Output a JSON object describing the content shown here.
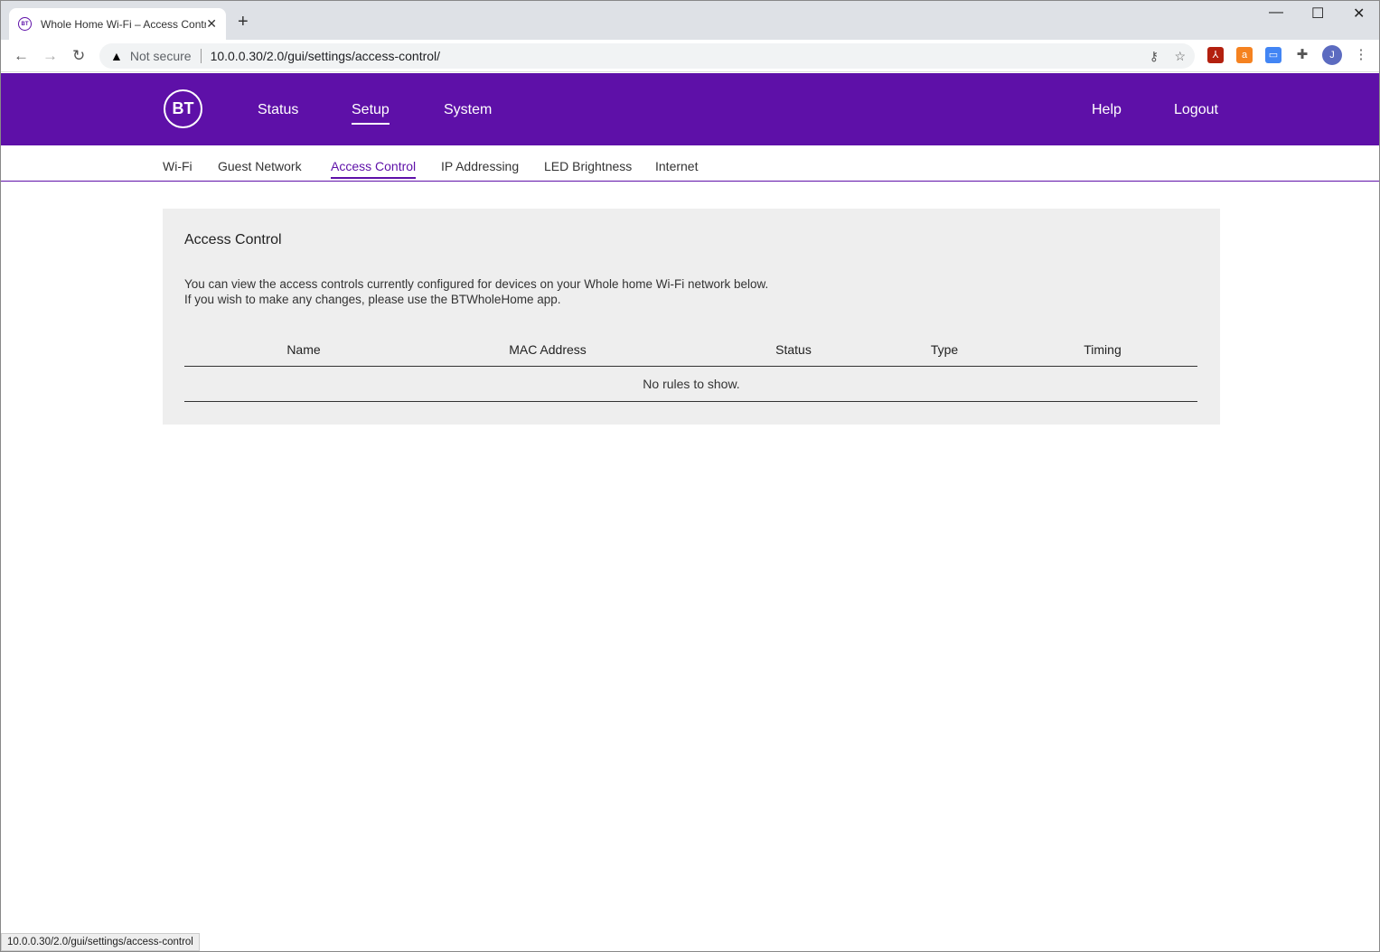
{
  "browser": {
    "tab_title": "Whole Home Wi-Fi – Access Control",
    "favicon": "BT",
    "security": "Not secure",
    "url": "10.0.0.30/2.0/gui/settings/access-control/",
    "profile_initial": "J",
    "status_url": "10.0.0.30/2.0/gui/settings/access-control"
  },
  "header": {
    "logo": "BT",
    "nav": [
      "Status",
      "Setup",
      "System"
    ],
    "help": "Help",
    "logout": "Logout"
  },
  "subnav": [
    "Wi-Fi",
    "Guest Network",
    "Access Control",
    "IP Addressing",
    "LED Brightness",
    "Internet"
  ],
  "panel": {
    "title": "Access Control",
    "desc1": "You can view the access controls currently configured for devices on your Whole home Wi-Fi network below.",
    "desc2": "If you wish to make any changes, please use the BTWholeHome app.",
    "columns": [
      "Name",
      "MAC Address",
      "Status",
      "Type",
      "Timing"
    ],
    "empty": "No rules to show."
  },
  "colors": {
    "brand": "#5e10a8"
  }
}
